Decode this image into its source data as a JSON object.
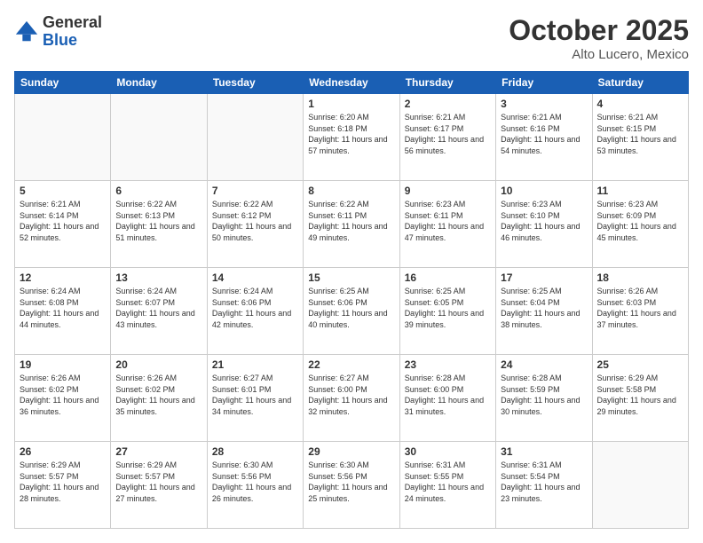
{
  "header": {
    "logo_general": "General",
    "logo_blue": "Blue",
    "month": "October 2025",
    "location": "Alto Lucero, Mexico"
  },
  "weekdays": [
    "Sunday",
    "Monday",
    "Tuesday",
    "Wednesday",
    "Thursday",
    "Friday",
    "Saturday"
  ],
  "weeks": [
    [
      {
        "day": "",
        "sunrise": "",
        "sunset": "",
        "daylight": ""
      },
      {
        "day": "",
        "sunrise": "",
        "sunset": "",
        "daylight": ""
      },
      {
        "day": "",
        "sunrise": "",
        "sunset": "",
        "daylight": ""
      },
      {
        "day": "1",
        "sunrise": "Sunrise: 6:20 AM",
        "sunset": "Sunset: 6:18 PM",
        "daylight": "Daylight: 11 hours and 57 minutes."
      },
      {
        "day": "2",
        "sunrise": "Sunrise: 6:21 AM",
        "sunset": "Sunset: 6:17 PM",
        "daylight": "Daylight: 11 hours and 56 minutes."
      },
      {
        "day": "3",
        "sunrise": "Sunrise: 6:21 AM",
        "sunset": "Sunset: 6:16 PM",
        "daylight": "Daylight: 11 hours and 54 minutes."
      },
      {
        "day": "4",
        "sunrise": "Sunrise: 6:21 AM",
        "sunset": "Sunset: 6:15 PM",
        "daylight": "Daylight: 11 hours and 53 minutes."
      }
    ],
    [
      {
        "day": "5",
        "sunrise": "Sunrise: 6:21 AM",
        "sunset": "Sunset: 6:14 PM",
        "daylight": "Daylight: 11 hours and 52 minutes."
      },
      {
        "day": "6",
        "sunrise": "Sunrise: 6:22 AM",
        "sunset": "Sunset: 6:13 PM",
        "daylight": "Daylight: 11 hours and 51 minutes."
      },
      {
        "day": "7",
        "sunrise": "Sunrise: 6:22 AM",
        "sunset": "Sunset: 6:12 PM",
        "daylight": "Daylight: 11 hours and 50 minutes."
      },
      {
        "day": "8",
        "sunrise": "Sunrise: 6:22 AM",
        "sunset": "Sunset: 6:11 PM",
        "daylight": "Daylight: 11 hours and 49 minutes."
      },
      {
        "day": "9",
        "sunrise": "Sunrise: 6:23 AM",
        "sunset": "Sunset: 6:11 PM",
        "daylight": "Daylight: 11 hours and 47 minutes."
      },
      {
        "day": "10",
        "sunrise": "Sunrise: 6:23 AM",
        "sunset": "Sunset: 6:10 PM",
        "daylight": "Daylight: 11 hours and 46 minutes."
      },
      {
        "day": "11",
        "sunrise": "Sunrise: 6:23 AM",
        "sunset": "Sunset: 6:09 PM",
        "daylight": "Daylight: 11 hours and 45 minutes."
      }
    ],
    [
      {
        "day": "12",
        "sunrise": "Sunrise: 6:24 AM",
        "sunset": "Sunset: 6:08 PM",
        "daylight": "Daylight: 11 hours and 44 minutes."
      },
      {
        "day": "13",
        "sunrise": "Sunrise: 6:24 AM",
        "sunset": "Sunset: 6:07 PM",
        "daylight": "Daylight: 11 hours and 43 minutes."
      },
      {
        "day": "14",
        "sunrise": "Sunrise: 6:24 AM",
        "sunset": "Sunset: 6:06 PM",
        "daylight": "Daylight: 11 hours and 42 minutes."
      },
      {
        "day": "15",
        "sunrise": "Sunrise: 6:25 AM",
        "sunset": "Sunset: 6:06 PM",
        "daylight": "Daylight: 11 hours and 40 minutes."
      },
      {
        "day": "16",
        "sunrise": "Sunrise: 6:25 AM",
        "sunset": "Sunset: 6:05 PM",
        "daylight": "Daylight: 11 hours and 39 minutes."
      },
      {
        "day": "17",
        "sunrise": "Sunrise: 6:25 AM",
        "sunset": "Sunset: 6:04 PM",
        "daylight": "Daylight: 11 hours and 38 minutes."
      },
      {
        "day": "18",
        "sunrise": "Sunrise: 6:26 AM",
        "sunset": "Sunset: 6:03 PM",
        "daylight": "Daylight: 11 hours and 37 minutes."
      }
    ],
    [
      {
        "day": "19",
        "sunrise": "Sunrise: 6:26 AM",
        "sunset": "Sunset: 6:02 PM",
        "daylight": "Daylight: 11 hours and 36 minutes."
      },
      {
        "day": "20",
        "sunrise": "Sunrise: 6:26 AM",
        "sunset": "Sunset: 6:02 PM",
        "daylight": "Daylight: 11 hours and 35 minutes."
      },
      {
        "day": "21",
        "sunrise": "Sunrise: 6:27 AM",
        "sunset": "Sunset: 6:01 PM",
        "daylight": "Daylight: 11 hours and 34 minutes."
      },
      {
        "day": "22",
        "sunrise": "Sunrise: 6:27 AM",
        "sunset": "Sunset: 6:00 PM",
        "daylight": "Daylight: 11 hours and 32 minutes."
      },
      {
        "day": "23",
        "sunrise": "Sunrise: 6:28 AM",
        "sunset": "Sunset: 6:00 PM",
        "daylight": "Daylight: 11 hours and 31 minutes."
      },
      {
        "day": "24",
        "sunrise": "Sunrise: 6:28 AM",
        "sunset": "Sunset: 5:59 PM",
        "daylight": "Daylight: 11 hours and 30 minutes."
      },
      {
        "day": "25",
        "sunrise": "Sunrise: 6:29 AM",
        "sunset": "Sunset: 5:58 PM",
        "daylight": "Daylight: 11 hours and 29 minutes."
      }
    ],
    [
      {
        "day": "26",
        "sunrise": "Sunrise: 6:29 AM",
        "sunset": "Sunset: 5:57 PM",
        "daylight": "Daylight: 11 hours and 28 minutes."
      },
      {
        "day": "27",
        "sunrise": "Sunrise: 6:29 AM",
        "sunset": "Sunset: 5:57 PM",
        "daylight": "Daylight: 11 hours and 27 minutes."
      },
      {
        "day": "28",
        "sunrise": "Sunrise: 6:30 AM",
        "sunset": "Sunset: 5:56 PM",
        "daylight": "Daylight: 11 hours and 26 minutes."
      },
      {
        "day": "29",
        "sunrise": "Sunrise: 6:30 AM",
        "sunset": "Sunset: 5:56 PM",
        "daylight": "Daylight: 11 hours and 25 minutes."
      },
      {
        "day": "30",
        "sunrise": "Sunrise: 6:31 AM",
        "sunset": "Sunset: 5:55 PM",
        "daylight": "Daylight: 11 hours and 24 minutes."
      },
      {
        "day": "31",
        "sunrise": "Sunrise: 6:31 AM",
        "sunset": "Sunset: 5:54 PM",
        "daylight": "Daylight: 11 hours and 23 minutes."
      },
      {
        "day": "",
        "sunrise": "",
        "sunset": "",
        "daylight": ""
      }
    ]
  ]
}
